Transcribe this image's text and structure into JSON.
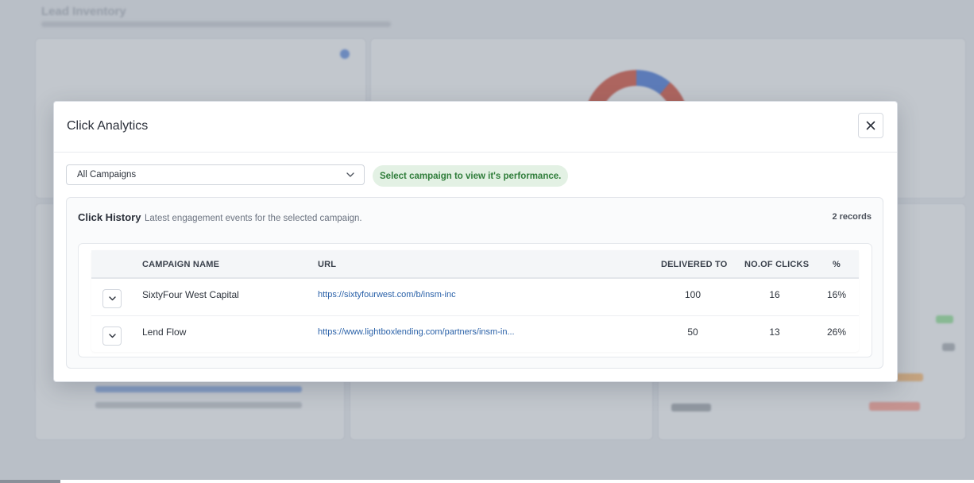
{
  "background": {
    "page_title": "Lead Inventory"
  },
  "modal": {
    "title": "Click Analytics",
    "close_icon": "close-icon"
  },
  "filter": {
    "selected": "All Campaigns",
    "hint": "Select campaign to view it's performance."
  },
  "history": {
    "title": "Click History",
    "subtitle": "Latest engagement events for the selected campaign.",
    "records": "2 records",
    "columns": [
      "CAMPAIGN NAME",
      "URL",
      "DELIVERED TO",
      "NO.OF CLICKS",
      "%"
    ],
    "rows": [
      {
        "campaign": "SixtyFour West Capital",
        "url": "https://sixtyfourwest.com/b/insm-inc",
        "delivered": "100",
        "clicks": "16",
        "pct": "16%"
      },
      {
        "campaign": "Lend Flow",
        "url": "https://www.lightboxlending.com/partners/insm-in...",
        "delivered": "50",
        "clicks": "13",
        "pct": "26%"
      }
    ]
  },
  "colors": {
    "accent_green_bg": "#e3f1e4",
    "accent_green_text": "#2f7d3a",
    "link": "#2a61a8"
  }
}
